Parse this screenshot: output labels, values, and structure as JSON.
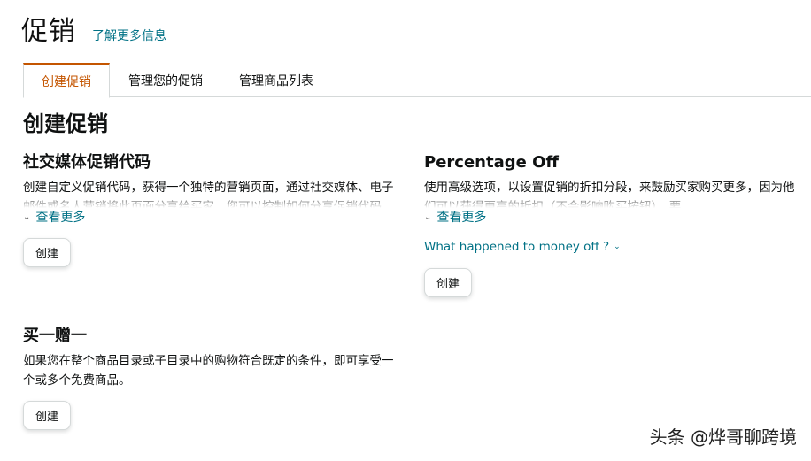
{
  "header": {
    "title": "促销",
    "learn_more": "了解更多信息"
  },
  "tabs": [
    {
      "label": "创建促销",
      "active": true
    },
    {
      "label": "管理您的促销",
      "active": false
    },
    {
      "label": "管理商品列表",
      "active": false
    }
  ],
  "section_title": "创建促销",
  "cards": {
    "social": {
      "title": "社交媒体促销代码",
      "description": "创建自定义促销代码，获得一个独特的营销页面，通过社交媒体、电子邮件或名人营销将此页面分享给买家。您可以控制如何分享促销代码。",
      "see_more": "查看更多",
      "button": "创建"
    },
    "percentage": {
      "title": "Percentage Off",
      "description": "使用高级选项，以设置促销的折扣分段，来鼓励买家购买更多，因为他们可以获得更高的折扣（不会影响购买按钮），要",
      "see_more": "查看更多",
      "what_happened": "What happened to money off ?",
      "button": "创建"
    },
    "bogo": {
      "title": "买一赠一",
      "description": "如果您在整个商品目录或子目录中的购物符合既定的条件，即可享受一个或多个免费商品。",
      "button": "创建"
    }
  },
  "watermark": "头条 @烨哥聊跨境",
  "colors": {
    "accent_tab": "#c45500",
    "link": "#007185",
    "border": "#d5d9d9"
  }
}
